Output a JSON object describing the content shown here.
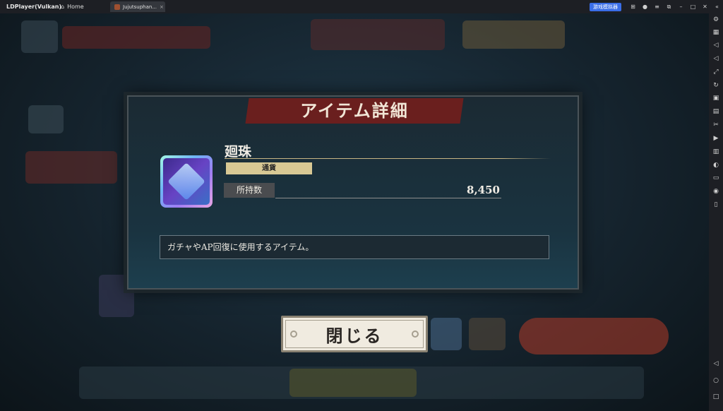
{
  "window": {
    "app_title": "LDPlayer(Vulkan)",
    "home_label": "Home",
    "tab_label": "Jujutsuphan...",
    "tab_close": "×",
    "badge_label": "游戏模拟器"
  },
  "dialog": {
    "title": "アイテム詳細",
    "item_name": "廻珠",
    "category": "通貨",
    "owned_label": "所持数",
    "owned_value": "8,450",
    "description": "ガチャやAP回復に使用するアイテム。"
  },
  "buttons": {
    "close": "閉じる"
  },
  "icons": {
    "titlebar_right": [
      "gamepad-icon",
      "account-icon",
      "menu-icon",
      "restore-small-icon",
      "minimize-icon",
      "maximize-icon",
      "close-icon",
      "collapse-icon"
    ],
    "sidebar": [
      "settings-icon",
      "keyboard-icon",
      "volume-up-icon",
      "volume-down-icon",
      "resize-icon",
      "sync-icon",
      "add-apk-icon",
      "screenshot-icon",
      "scissors-icon",
      "record-icon",
      "multi-instance-icon",
      "rotate-icon",
      "folder-icon",
      "location-icon",
      "shake-icon",
      "back-icon",
      "home-icon",
      "recents-icon"
    ]
  },
  "colors": {
    "title_banner": "#6a1f1e",
    "category_tag": "#d8c894",
    "badge": "#3a6ee8"
  }
}
